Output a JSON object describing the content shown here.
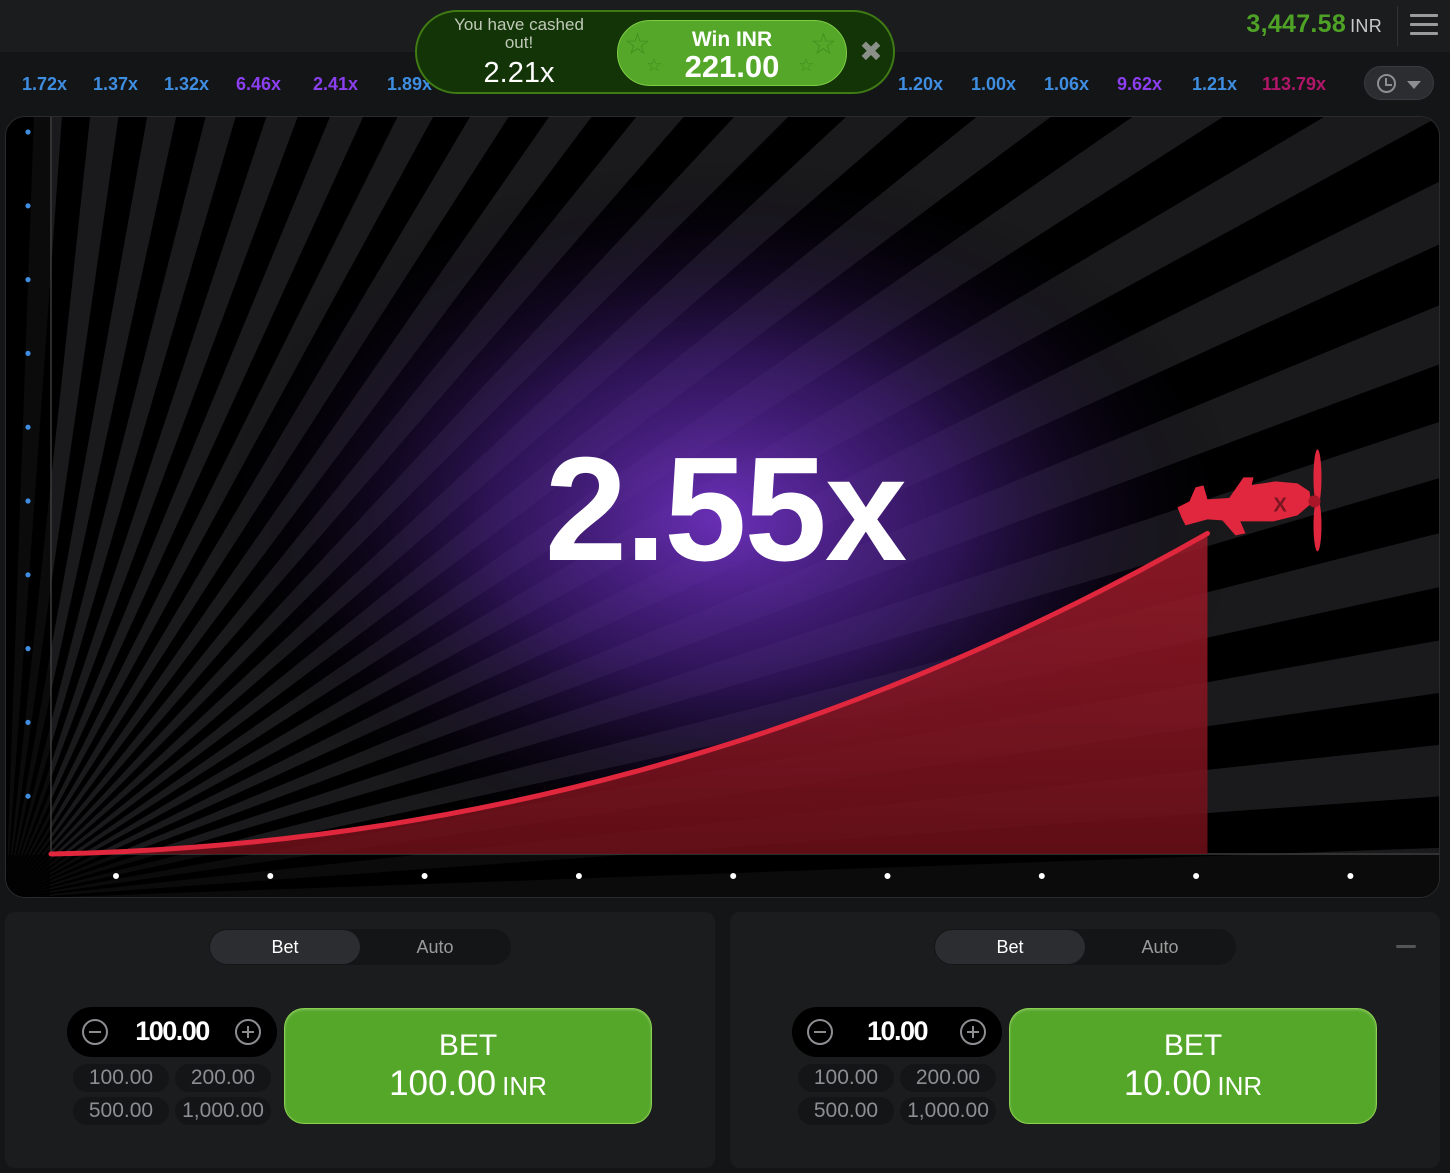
{
  "header": {
    "balance": "3,447.58",
    "currency": "INR"
  },
  "history": {
    "multipliers": [
      {
        "value": "1.72x",
        "color": "#3f8de0"
      },
      {
        "value": "1.37x",
        "color": "#3f8de0"
      },
      {
        "value": "1.32x",
        "color": "#3f8de0"
      },
      {
        "value": "6.46x",
        "color": "#8b3ff0"
      },
      {
        "value": "2.41x",
        "color": "#8b3ff0"
      },
      {
        "value": "1.89x",
        "color": "#3f8de0"
      },
      {
        "value": "1.20x",
        "color": "#3f8de0"
      },
      {
        "value": "1.00x",
        "color": "#3f8de0"
      },
      {
        "value": "1.06x",
        "color": "#3f8de0"
      },
      {
        "value": "9.62x",
        "color": "#8b3ff0"
      },
      {
        "value": "1.21x",
        "color": "#3f8de0"
      },
      {
        "value": "113.79x",
        "color": "#b1166a"
      }
    ]
  },
  "toast": {
    "message": "You have cashed out!",
    "multiplier": "2.21x",
    "win_label": "Win INR",
    "win_amount": "221.00"
  },
  "game": {
    "multiplier": "2.55x",
    "progress": 0.8,
    "curve_color": "#e0273d",
    "plane_color": "#e0273d",
    "icons": [
      "plane-icon"
    ]
  },
  "panels": [
    {
      "tabs": [
        "Bet",
        "Auto"
      ],
      "stake": "100.00",
      "quick": [
        "100.00",
        "200.00",
        "500.00",
        "1,000.00"
      ],
      "bet_label": "BET",
      "bet_amount": "100.00",
      "bet_currency": "INR"
    },
    {
      "tabs": [
        "Bet",
        "Auto"
      ],
      "stake": "10.00",
      "quick": [
        "100.00",
        "200.00",
        "500.00",
        "1,000.00"
      ],
      "bet_label": "BET",
      "bet_amount": "10.00",
      "bet_currency": "INR"
    }
  ],
  "colors": {
    "accent_green": "#55a72a",
    "balance_green": "#4ea226",
    "background": "#141516",
    "panel": "#1b1c1d"
  }
}
